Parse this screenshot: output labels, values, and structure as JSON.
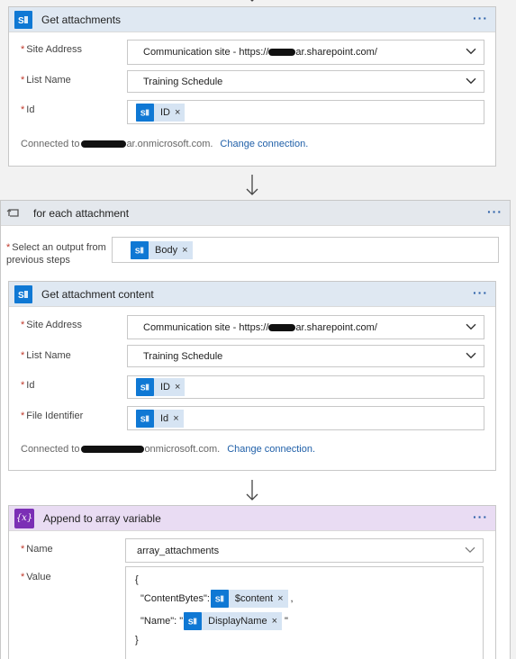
{
  "card1": {
    "title": "Get attachments",
    "more": "···",
    "site_label": "Site Address",
    "site_value_prefix": "Communication site - https://",
    "site_value_suffix": "ar.sharepoint.com/",
    "list_label": "List Name",
    "list_value": "Training Schedule",
    "id_label": "Id",
    "id_token": "ID",
    "connected_prefix": "Connected to",
    "connected_suffix": "ar.onmicrosoft.com.",
    "change_link": "Change connection."
  },
  "loop": {
    "title": "for each attachment",
    "more": "···",
    "select_label_1": "Select an output from",
    "select_label_2": "previous steps",
    "body_token": "Body"
  },
  "card2": {
    "title": "Get attachment content",
    "more": "···",
    "site_label": "Site Address",
    "site_value_prefix": "Communication site - https://",
    "site_value_suffix": "ar.sharepoint.com/",
    "list_label": "List Name",
    "list_value": "Training Schedule",
    "id_label": "Id",
    "id_token": "ID",
    "file_label": "File Identifier",
    "file_token": "Id",
    "connected_prefix": "Connected to",
    "connected_suffix": "onmicrosoft.com.",
    "change_link": "Change connection."
  },
  "card3": {
    "title": "Append to array variable",
    "more": "···",
    "var_icon": "{x}",
    "name_label": "Name",
    "name_value": "array_attachments",
    "value_label": "Value",
    "line_open": "{",
    "line_content_key": "\"ContentBytes\":",
    "content_token": "$content",
    "line_content_after": ",",
    "line_name_key": "\"Name\": \"",
    "name_token": "DisplayName",
    "line_name_after": "\"",
    "line_close": "}"
  },
  "tokens": {
    "remove": "×"
  },
  "colors": {
    "sharepoint": "#0f78d4",
    "variable": "#7b2fb5",
    "link": "#1f5fa8",
    "required": "#c0392b"
  }
}
